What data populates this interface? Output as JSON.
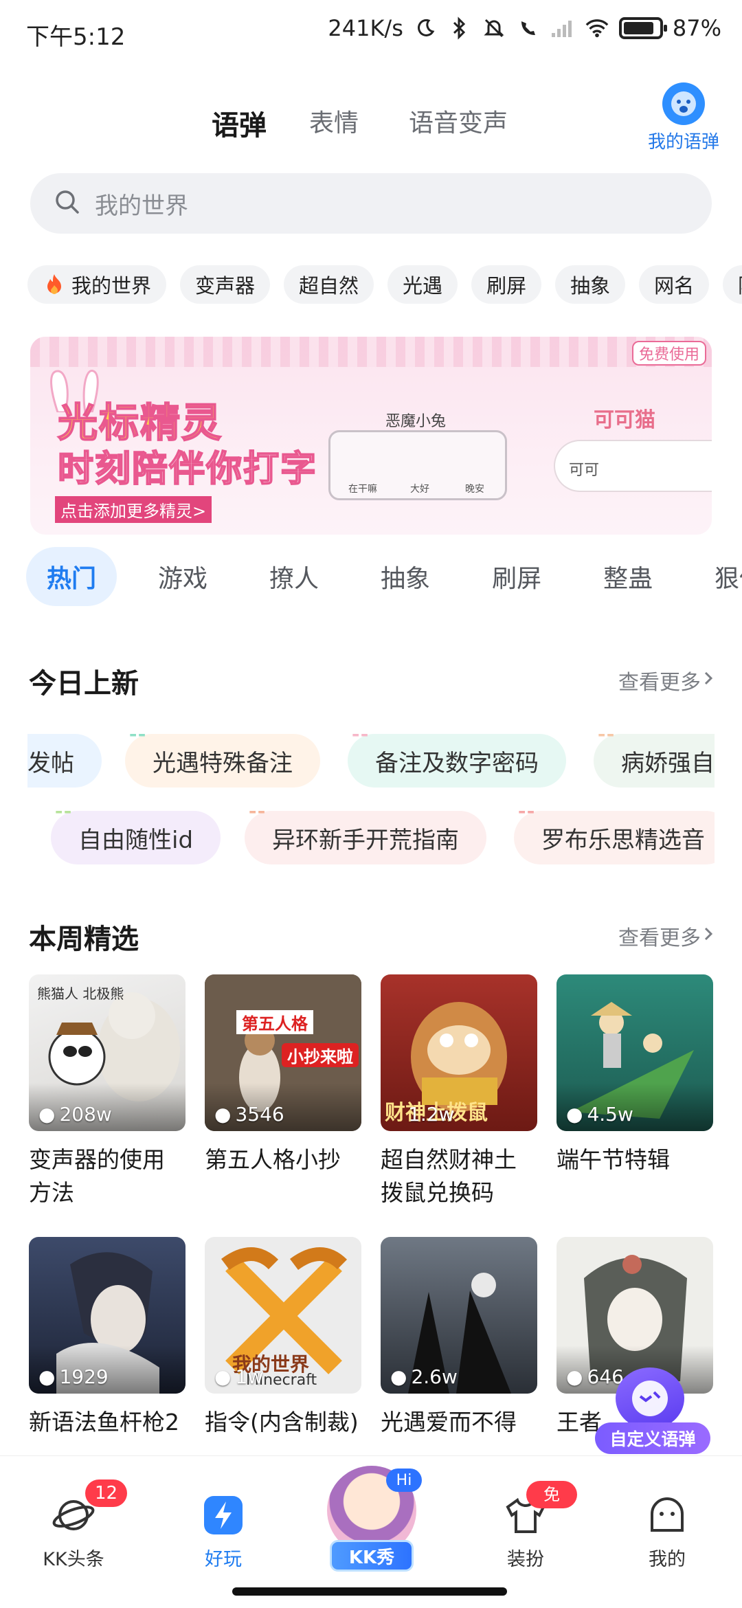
{
  "status_bar": {
    "time": "下午5:12",
    "speed": "241K/s",
    "battery": "87%",
    "battery_level": 0.87
  },
  "top_tabs": [
    {
      "label": "语弹",
      "active": true
    },
    {
      "label": "表情",
      "active": false
    },
    {
      "label": "语音变声",
      "active": false
    }
  ],
  "my_yudan_label": "我的语弹",
  "search": {
    "placeholder": "我的世界"
  },
  "chips": [
    "我的世界",
    "变声器",
    "超自然",
    "光遇",
    "刷屏",
    "抽象",
    "网名",
    "隐"
  ],
  "banner": {
    "title_line1": "光标精灵",
    "title_line2": "时刻陪伴你打字",
    "cta": "点击添加更多精灵>",
    "free_tag": "免费使用",
    "card_name": "恶魔小兔",
    "card_labels": [
      "在干嘛",
      "大好",
      "晚安"
    ],
    "right_name": "可可猫",
    "right_input": "可可"
  },
  "category_tabs": [
    {
      "label": "热门",
      "active": true
    },
    {
      "label": "游戏",
      "active": false
    },
    {
      "label": "撩人",
      "active": false
    },
    {
      "label": "抽象",
      "active": false
    },
    {
      "label": "刷屏",
      "active": false
    },
    {
      "label": "整蛊",
      "active": false
    },
    {
      "label": "狠伤",
      "active": false
    }
  ],
  "today_new": {
    "title": "今日上新",
    "more": "查看更多",
    "row1": [
      "发帖",
      "光遇特殊备注",
      "备注及数字密码",
      "病娇强自"
    ],
    "row2": [
      "自由随性id",
      "异环新手开荒指南",
      "罗布乐思精选音"
    ]
  },
  "weekly": {
    "title": "本周精选",
    "more": "查看更多",
    "cards": [
      {
        "title": "变声器的使用方法",
        "views": "208w",
        "overlay": "熊猫人 北极熊"
      },
      {
        "title": "第五人格小抄",
        "views": "3546",
        "overlay": "第五人格 小抄来啦"
      },
      {
        "title": "超自然财神土拨鼠兑换码",
        "views": "1.2w",
        "overlay": "财神土拨鼠"
      },
      {
        "title": "端午节特辑",
        "views": "4.5w",
        "overlay": ""
      },
      {
        "title": "新语法鱼杆枪2",
        "views": "1929",
        "overlay": ""
      },
      {
        "title": "指令(内含制裁)",
        "views": "1w",
        "overlay": "我的世界 Minecraft"
      },
      {
        "title": "光遇爱而不得",
        "views": "2.6w",
        "overlay": ""
      },
      {
        "title": "王者",
        "views": "646",
        "overlay": ""
      }
    ]
  },
  "float_custom": "自定义语弹",
  "bottom_nav": [
    {
      "label": "KK头条",
      "badge": "12",
      "active": false
    },
    {
      "label": "好玩",
      "badge": "",
      "active": true
    },
    {
      "label": "KK秀",
      "badge": "Hi",
      "active": false
    },
    {
      "label": "装扮",
      "badge": "免费",
      "active": false
    },
    {
      "label": "我的",
      "badge": "",
      "active": false
    }
  ],
  "colors": {
    "accent": "#1f7cf0",
    "tab_highlight": "#ffd526",
    "badge": "#ff3b4a"
  }
}
